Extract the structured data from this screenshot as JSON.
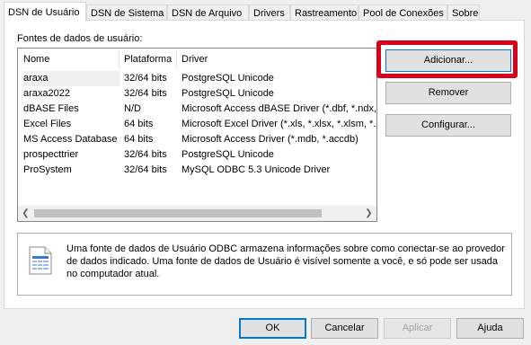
{
  "tabs": [
    "DSN de Usuário",
    "DSN de Sistema",
    "DSN de Arquivo",
    "Drivers",
    "Rastreamento",
    "Pool de Conexões",
    "Sobre"
  ],
  "panel": {
    "sources_label": "Fontes de dados de usuário:",
    "columns": [
      "Nome",
      "Plataforma",
      "Driver"
    ],
    "rows": [
      {
        "name": "araxa",
        "platform": "32/64 bits",
        "driver": "PostgreSQL Unicode"
      },
      {
        "name": "araxa2022",
        "platform": "32/64 bits",
        "driver": "PostgreSQL Unicode"
      },
      {
        "name": "dBASE Files",
        "platform": "N/D",
        "driver": "Microsoft Access dBASE Driver (*.dbf, *.ndx, *.mdx)"
      },
      {
        "name": "Excel Files",
        "platform": "64 bits",
        "driver": "Microsoft Excel Driver (*.xls, *.xlsx, *.xlsm, *.xlsb)"
      },
      {
        "name": "MS Access Database",
        "platform": "64 bits",
        "driver": "Microsoft Access Driver (*.mdb, *.accdb)"
      },
      {
        "name": "prospecttrier",
        "platform": "32/64 bits",
        "driver": "PostgreSQL Unicode"
      },
      {
        "name": "ProSystem",
        "platform": "32/64 bits",
        "driver": "MySQL ODBC 5.3 Unicode Driver"
      }
    ],
    "buttons": {
      "add": "Adicionar...",
      "remove": "Remover",
      "configure": "Configurar..."
    },
    "info_text": "Uma fonte de dados de Usuário ODBC armazena informações sobre como conectar-se ao provedor de dados indicado. Uma fonte de dados de Usuário é visível somente a você, e só pode ser usada no computador atual."
  },
  "footer": {
    "ok": "OK",
    "cancel": "Cancelar",
    "apply": "Aplicar",
    "help": "Ajuda"
  },
  "colors": {
    "highlight": "#d9001c",
    "focus": "#0078d7"
  }
}
